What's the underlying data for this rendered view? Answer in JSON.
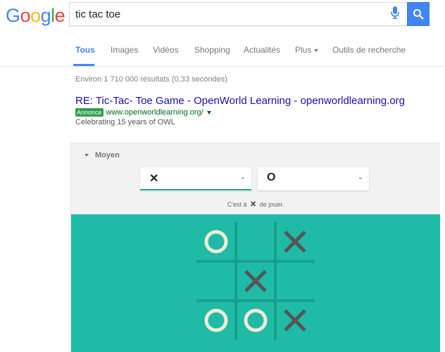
{
  "logo": {
    "text": "Google"
  },
  "search": {
    "query": "tic tac toe"
  },
  "tabs": [
    {
      "label": "Tous"
    },
    {
      "label": "Images"
    },
    {
      "label": "Vidéos"
    },
    {
      "label": "Shopping"
    },
    {
      "label": "Actualités"
    },
    {
      "label": "Plus"
    },
    {
      "label": "Outils de recherche"
    }
  ],
  "results_stats": "Environ 1 710 000 résultats (0,33 secondes)",
  "ad": {
    "title": "RE: Tic-Tac- Toe Game - OpenWorld Learning - openworldlearning.org",
    "badge": "Annonce",
    "url": "www.openworldlearning.org/",
    "description": "Celebrating 15 years of OWL"
  },
  "game": {
    "difficulty": "Moyen",
    "player_x": {
      "mark": "✕",
      "score": "-"
    },
    "player_o": {
      "mark": "O",
      "score": "-"
    },
    "turn_prefix": "C'est à",
    "turn_mark": "✕",
    "turn_suffix": "de jouer.",
    "board": [
      [
        "O",
        "",
        "X"
      ],
      [
        "",
        "X",
        ""
      ],
      [
        "O",
        "O",
        "X"
      ]
    ],
    "colors": {
      "board_bg": "#1fbba6",
      "grid": "#16a08d",
      "x": "#555555",
      "o": "#f2ebd3"
    }
  }
}
